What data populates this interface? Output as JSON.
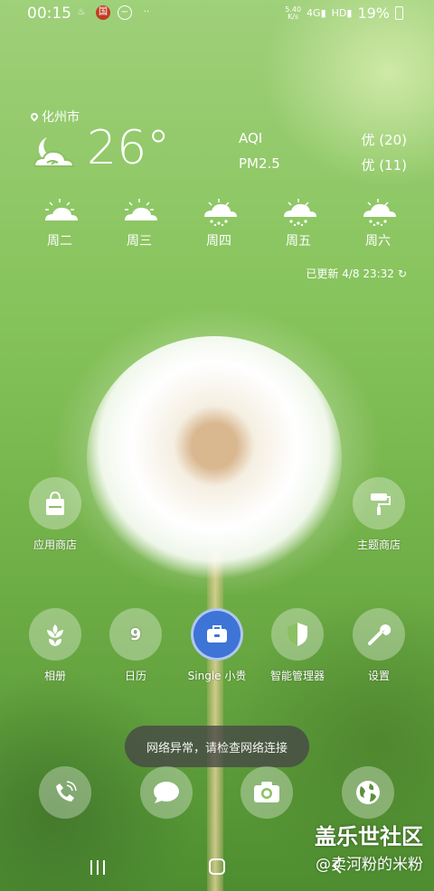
{
  "status_bar": {
    "time": "00:15",
    "net_speed_value": "5.40",
    "net_speed_unit": "K/s",
    "network_1": "4G",
    "network_2": "HD",
    "battery": "19%"
  },
  "weather": {
    "location": "化州市",
    "temperature": "26°",
    "aqi_label": "AQI",
    "aqi_value": "优 (20)",
    "pm_label": "PM2.5",
    "pm_value": "优 (11)",
    "forecast": [
      {
        "day": "周二",
        "icon": "cloudy-sun-icon"
      },
      {
        "day": "周三",
        "icon": "cloudy-sun-icon"
      },
      {
        "day": "周四",
        "icon": "rain-icon"
      },
      {
        "day": "周五",
        "icon": "rain-icon"
      },
      {
        "day": "周六",
        "icon": "rain-icon"
      }
    ],
    "updated": "已更新 4/8 23:32"
  },
  "apps": {
    "app_store": "应用商店",
    "theme_store": "主题商店",
    "gallery": "相册",
    "calendar": "日历",
    "calendar_day": "9",
    "single": "Single 小贵",
    "manager": "智能管理器",
    "settings": "设置"
  },
  "toast": "网络异常，请检查网络连接",
  "watermark": {
    "line1": "盖乐世社区",
    "line2": "@卖河粉的米粉"
  },
  "colors": {
    "accent_blue": "#3d74d6",
    "wallpaper_green": "#86c35b"
  }
}
